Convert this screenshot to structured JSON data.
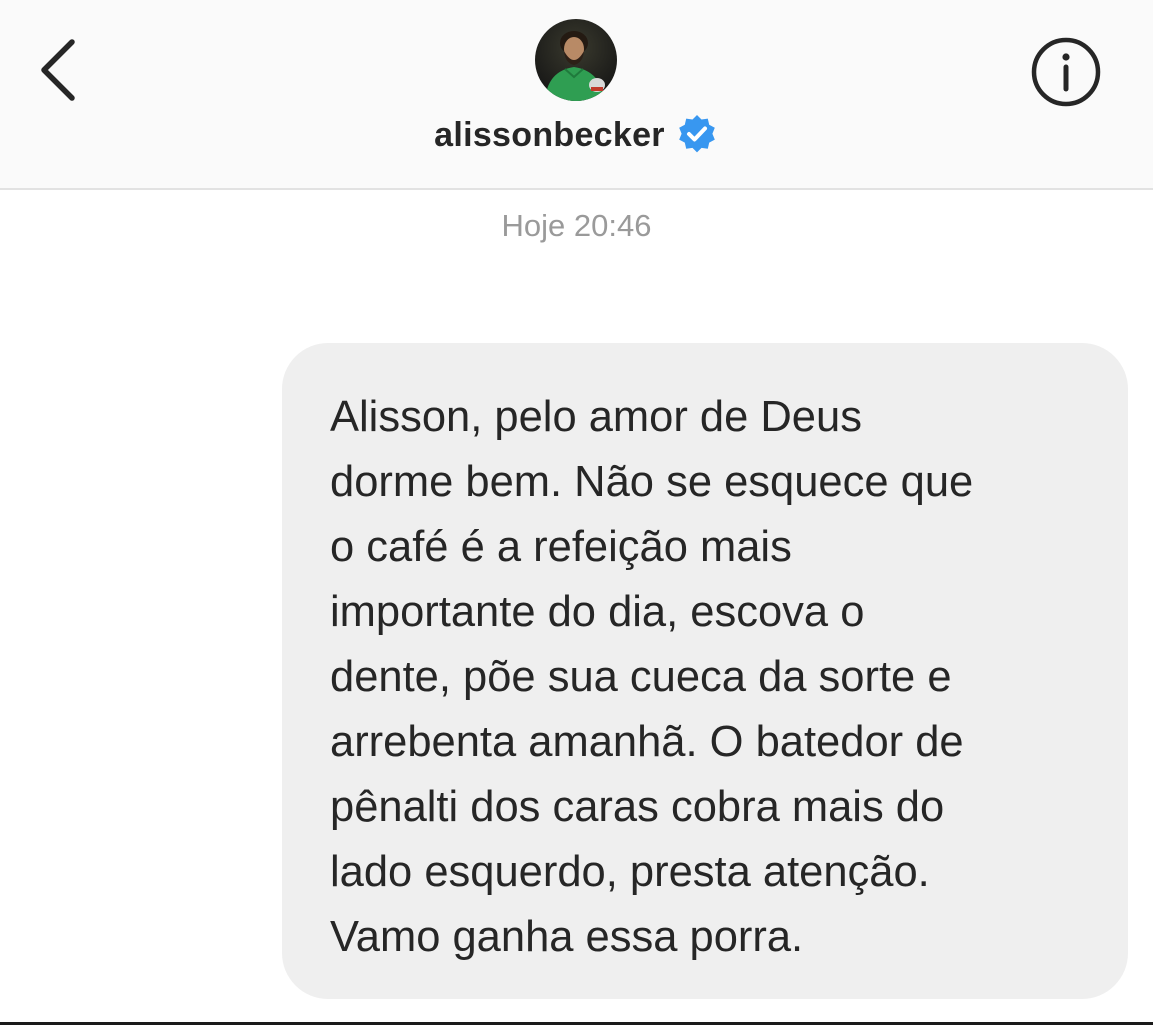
{
  "header": {
    "username": "alissonbecker",
    "verified": true,
    "back_icon": "chevron-left-icon",
    "info_icon": "info-circle-icon",
    "verified_color": "#3897f0"
  },
  "thread": {
    "timestamp": "Hoje 20:46",
    "messages": [
      {
        "direction": "incoming",
        "text": "Alisson, pelo amor de Deus\ndorme bem. Não se esquece que\no café é a refeição mais\nimportante do dia, escova o\ndente, põe sua cueca da sorte e\narrebenta amanhã. O batedor de\npênalti dos caras cobra mais do\nlado esquerdo, presta atenção.\nVamo ganha essa porra.",
        "bubble_color": "#efefef"
      }
    ]
  }
}
